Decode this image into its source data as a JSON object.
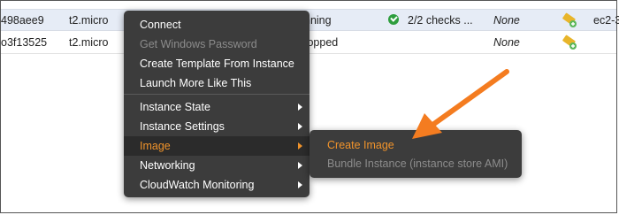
{
  "instances": [
    {
      "id": "498aee9",
      "type": "t2.micro",
      "state": "nning",
      "status_checks": "2/2 checks ...",
      "alarm_status": "None",
      "public_dns": "ec2-3"
    },
    {
      "id": "o3f13525",
      "type": "t2.micro",
      "state": "topped",
      "status_checks": "",
      "alarm_status": "None",
      "public_dns": ""
    }
  ],
  "context_menu": {
    "items": [
      {
        "label": "Connect",
        "disabled": false,
        "submenu": false
      },
      {
        "label": "Get Windows Password",
        "disabled": true,
        "submenu": false
      },
      {
        "label": "Create Template From Instance",
        "disabled": false,
        "submenu": false
      },
      {
        "label": "Launch More Like This",
        "disabled": false,
        "submenu": false
      },
      {
        "label": "Instance State",
        "disabled": false,
        "submenu": true
      },
      {
        "label": "Instance Settings",
        "disabled": false,
        "submenu": true
      },
      {
        "label": "Image",
        "disabled": false,
        "submenu": true,
        "active": true
      },
      {
        "label": "Networking",
        "disabled": false,
        "submenu": true
      },
      {
        "label": "CloudWatch Monitoring",
        "disabled": false,
        "submenu": true
      }
    ]
  },
  "image_submenu": {
    "items": [
      {
        "label": "Create Image",
        "highlighted": true
      },
      {
        "label": "Bundle Instance (instance store AMI)",
        "disabled": true
      }
    ]
  },
  "icons": {
    "status_ok": "check-circle-icon",
    "monitoring": "monitoring-icon",
    "submenu_arrow": "chevron-right-icon",
    "annotation": "orange-arrow-pointer"
  },
  "colors": {
    "menu_bg": "#3c3c3c",
    "accent": "#f0932b",
    "selected_row": "#e6ecf6",
    "status_ok": "#2e9e3e",
    "disabled_text": "#8c8c8c"
  }
}
